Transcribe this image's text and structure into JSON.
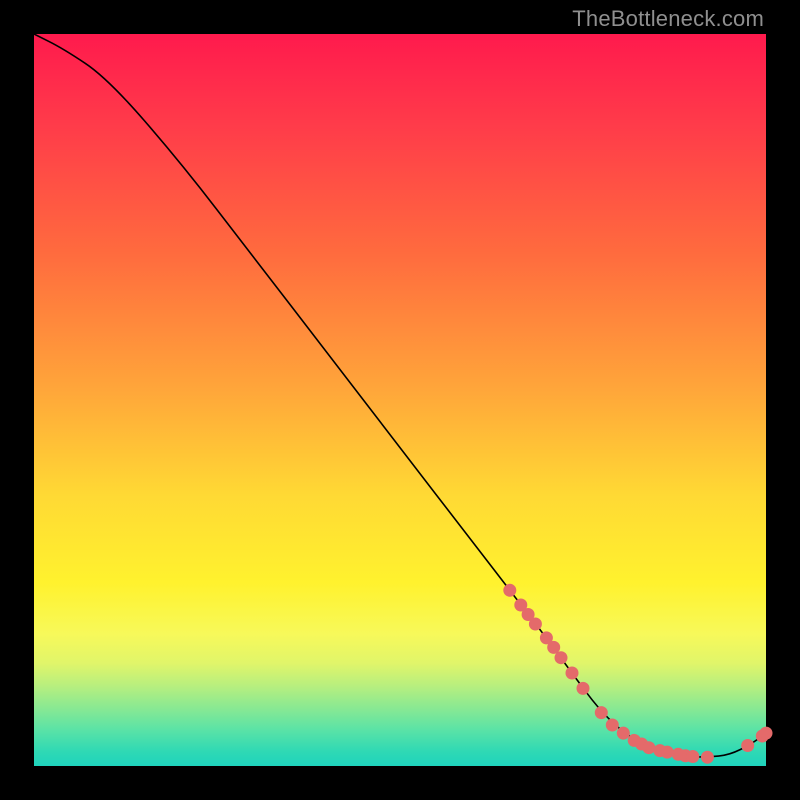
{
  "watermark": "TheBottleneck.com",
  "colors": {
    "dot": "#e46a6a",
    "line": "#000000"
  },
  "chart_data": {
    "type": "line",
    "title": "",
    "xlabel": "",
    "ylabel": "",
    "xlim": [
      0,
      100
    ],
    "ylim": [
      0,
      100
    ],
    "grid": false,
    "series": [
      {
        "name": "bottleneck-curve",
        "x": [
          0,
          4,
          10,
          20,
          30,
          40,
          50,
          60,
          66,
          70,
          74,
          77,
          80,
          83,
          86,
          89,
          92,
          95,
          98,
          100
        ],
        "y": [
          100,
          98,
          94,
          82.5,
          69.5,
          56.5,
          43.5,
          30.5,
          22.7,
          17.5,
          12,
          8,
          5,
          3,
          1.8,
          1.3,
          1.2,
          1.5,
          3,
          4.5
        ]
      }
    ],
    "scatter_on_curve": {
      "name": "highlighted-points",
      "x": [
        65,
        66.5,
        67.5,
        68.5,
        70,
        71,
        72,
        73.5,
        75,
        77.5,
        79,
        80.5,
        82,
        83,
        84,
        85.5,
        86.5,
        88,
        89,
        90,
        92,
        97.5,
        99.5,
        100
      ],
      "y": [
        24,
        22,
        20.7,
        19.4,
        17.5,
        16.2,
        14.8,
        12.7,
        10.6,
        7.3,
        5.6,
        4.5,
        3.5,
        3,
        2.5,
        2.1,
        1.9,
        1.6,
        1.4,
        1.3,
        1.2,
        2.8,
        4.1,
        4.5
      ]
    }
  }
}
